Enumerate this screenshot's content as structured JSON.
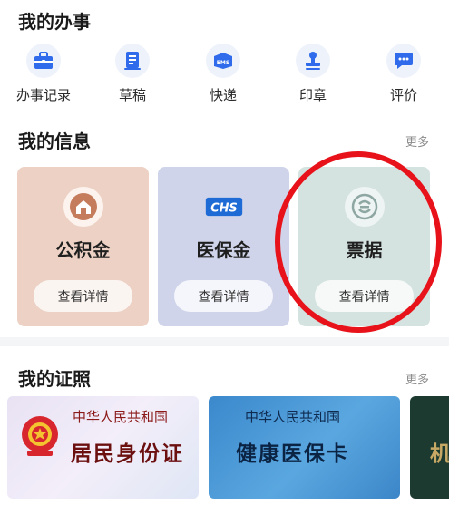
{
  "affairs": {
    "title": "我的办事",
    "items": [
      {
        "label": "办事记录",
        "icon": "briefcase-icon"
      },
      {
        "label": "草稿",
        "icon": "draft-icon"
      },
      {
        "label": "快递",
        "icon": "ems-icon"
      },
      {
        "label": "印章",
        "icon": "stamp-icon"
      },
      {
        "label": "评价",
        "icon": "chat-bubble-icon"
      }
    ],
    "ems_text": "EMS"
  },
  "info": {
    "title": "我的信息",
    "more": "更多",
    "cards": [
      {
        "name": "公积金",
        "button": "查看详情",
        "bg": "#ecd1c4",
        "icon": "house-fund-icon"
      },
      {
        "name": "医保金",
        "button": "查看详情",
        "bg": "#cfd4ea",
        "icon": "chs-logo-icon",
        "logo_text": "CHS"
      },
      {
        "name": "票据",
        "button": "查看详情",
        "bg": "#d4e3e0",
        "icon": "invoice-logo-icon"
      }
    ]
  },
  "certs": {
    "title": "我的证照",
    "more": "更多",
    "items": [
      {
        "header": "中华人民共和国",
        "name": "居民身份证",
        "icon": "national-emblem-icon"
      },
      {
        "header": "中华人民共和国",
        "name": "健康医保卡"
      },
      {
        "partial": "机"
      }
    ]
  },
  "colors": {
    "accent": "#2f6bea",
    "highlight": "#e8131a"
  }
}
